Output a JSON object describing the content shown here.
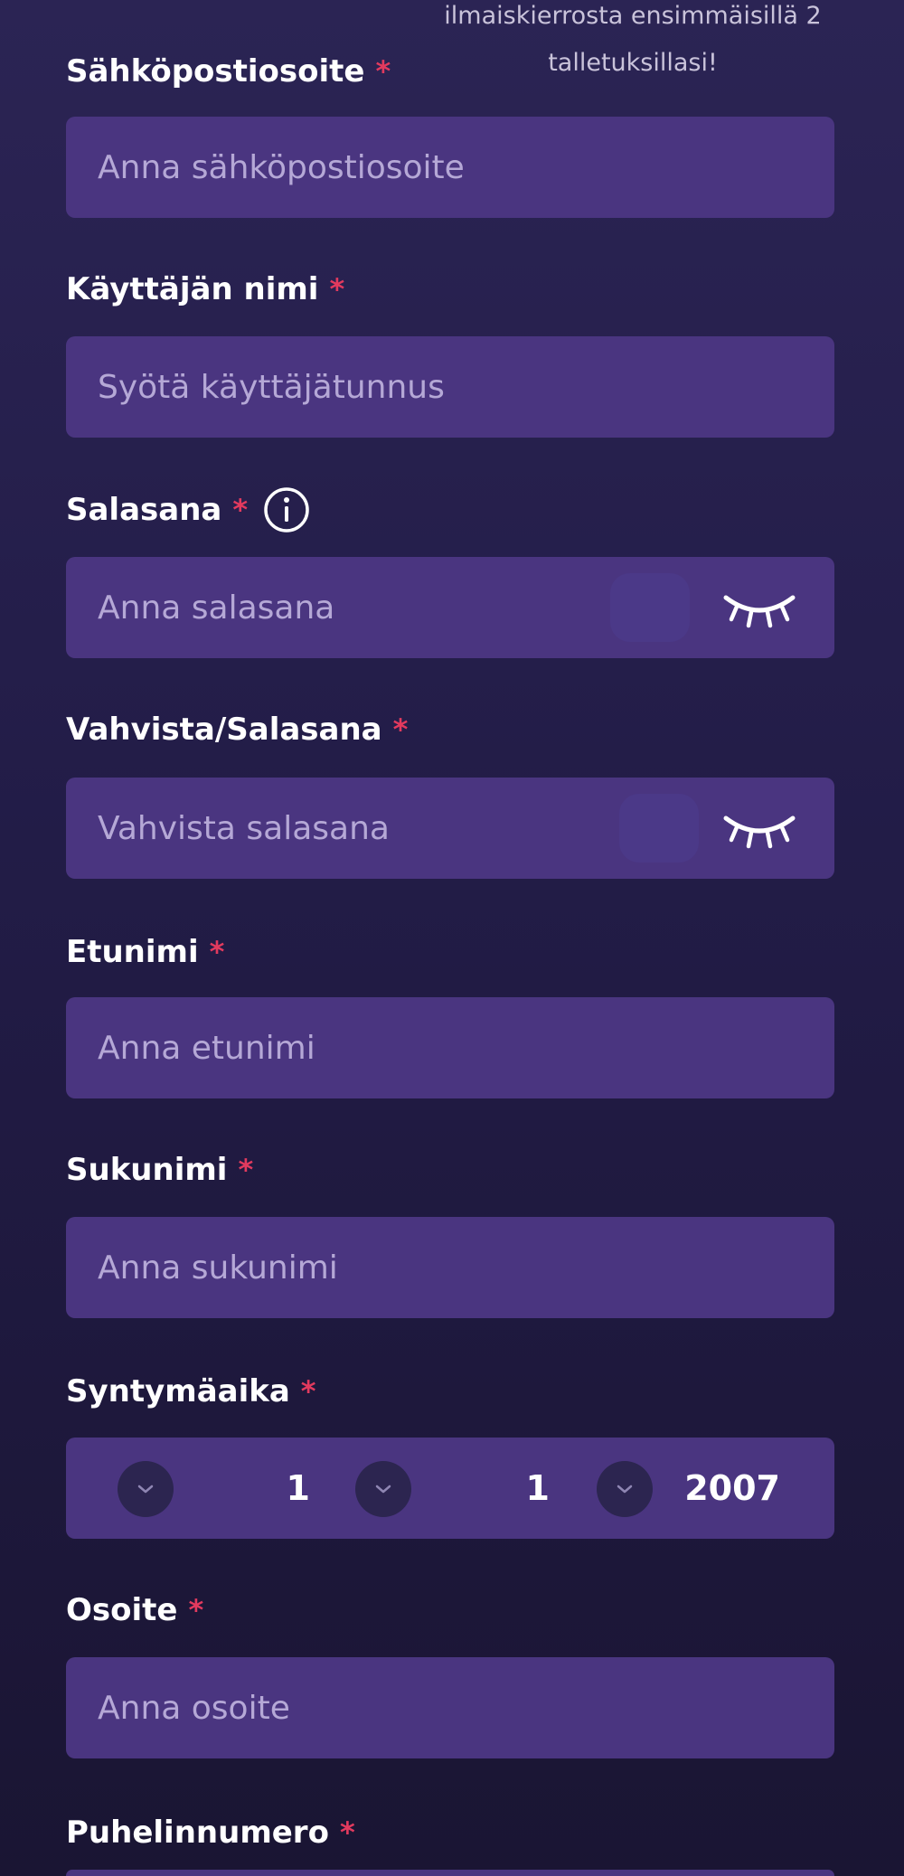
{
  "promo": {
    "line1": "ilmaiskierrosta ensimmäisillä 2",
    "line2": "talletuksillasi!"
  },
  "required_marker": "*",
  "fields": {
    "email": {
      "label": "Sähköpostiosoite",
      "placeholder": "Anna sähköpostiosoite",
      "value": ""
    },
    "username": {
      "label": "Käyttäjän nimi",
      "placeholder": "Syötä käyttäjätunnus",
      "value": ""
    },
    "password": {
      "label": "Salasana",
      "placeholder": "Anna salasana",
      "value": ""
    },
    "confirm_password": {
      "label": "Vahvista/Salasana",
      "placeholder": "Vahvista salasana",
      "value": ""
    },
    "first_name": {
      "label": "Etunimi",
      "placeholder": "Anna etunimi",
      "value": ""
    },
    "last_name": {
      "label": "Sukunimi",
      "placeholder": "Anna sukunimi",
      "value": ""
    },
    "birthdate": {
      "label": "Syntymäaika",
      "day": "1",
      "month": "1",
      "year": "2007"
    },
    "address": {
      "label": "Osoite",
      "placeholder": "Anna osoite",
      "value": ""
    },
    "phone": {
      "label": "Puhelinnumero"
    }
  },
  "icons": {
    "info": "info-icon",
    "password_toggle": "eye-closed-icon",
    "select": "chevron-down-icon"
  },
  "colors": {
    "background_top": "#2b2454",
    "background_bottom": "#1a1533",
    "input_background": "#4a3580",
    "placeholder": "#b5a8d6",
    "required": "#e23a5e",
    "promo_text": "#c9c3da",
    "chevron_circle": "#2c2550"
  }
}
